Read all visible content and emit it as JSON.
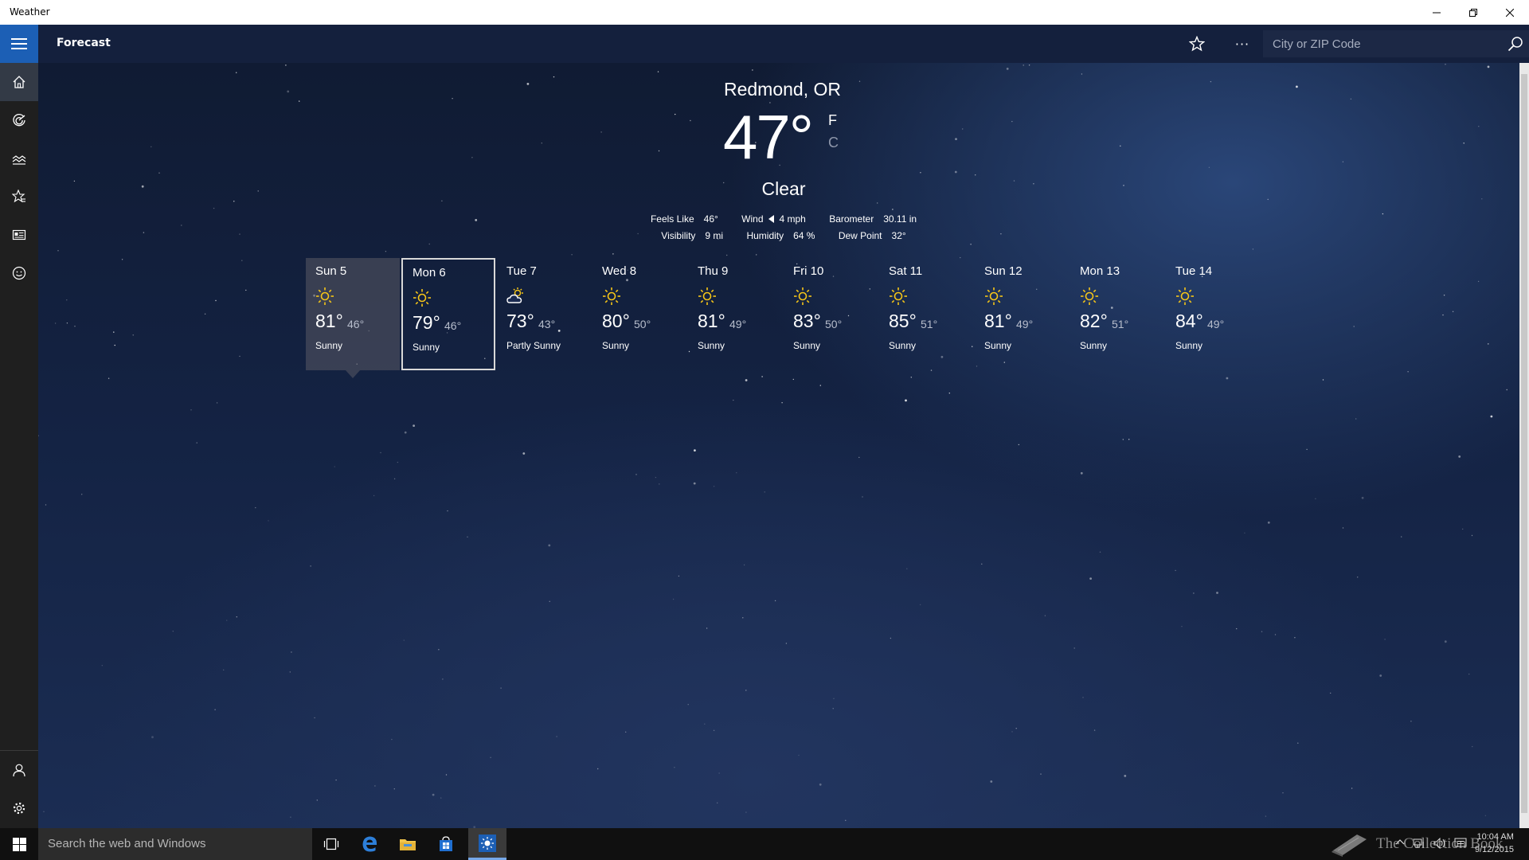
{
  "window": {
    "title": "Weather"
  },
  "appbar": {
    "heading": "Forecast",
    "more_label": "···",
    "search_placeholder": "City or ZIP Code"
  },
  "current": {
    "location": "Redmond, OR",
    "temperature": "47°",
    "unit_f": "F",
    "unit_c": "C",
    "condition": "Clear",
    "feels_like_label": "Feels Like",
    "feels_like": "46°",
    "wind_label": "Wind",
    "wind": "4 mph",
    "barometer_label": "Barometer",
    "barometer": "30.11 in",
    "visibility_label": "Visibility",
    "visibility": "9 mi",
    "humidity_label": "Humidity",
    "humidity": "64 %",
    "dew_point_label": "Dew Point",
    "dew_point": "32°"
  },
  "forecast": [
    {
      "day": "Sun 5",
      "hi": "81°",
      "lo": "46°",
      "cond": "Sunny",
      "icon": "sun-icon"
    },
    {
      "day": "Mon 6",
      "hi": "79°",
      "lo": "46°",
      "cond": "Sunny",
      "icon": "sun-icon"
    },
    {
      "day": "Tue 7",
      "hi": "73°",
      "lo": "43°",
      "cond": "Partly Sunny",
      "icon": "partly-sunny-icon"
    },
    {
      "day": "Wed 8",
      "hi": "80°",
      "lo": "50°",
      "cond": "Sunny",
      "icon": "sun-icon"
    },
    {
      "day": "Thu 9",
      "hi": "81°",
      "lo": "49°",
      "cond": "Sunny",
      "icon": "sun-icon"
    },
    {
      "day": "Fri 10",
      "hi": "83°",
      "lo": "50°",
      "cond": "Sunny",
      "icon": "sun-icon"
    },
    {
      "day": "Sat 11",
      "hi": "85°",
      "lo": "51°",
      "cond": "Sunny",
      "icon": "sun-icon"
    },
    {
      "day": "Sun 12",
      "hi": "81°",
      "lo": "49°",
      "cond": "Sunny",
      "icon": "sun-icon"
    },
    {
      "day": "Mon 13",
      "hi": "82°",
      "lo": "51°",
      "cond": "Sunny",
      "icon": "sun-icon"
    },
    {
      "day": "Tue 14",
      "hi": "84°",
      "lo": "49°",
      "cond": "Sunny",
      "icon": "sun-icon"
    }
  ],
  "sidebar": {
    "items": [
      {
        "icon": "home-icon"
      },
      {
        "icon": "radar-icon"
      },
      {
        "icon": "historical-weather-icon"
      },
      {
        "icon": "places-icon"
      },
      {
        "icon": "news-icon"
      },
      {
        "icon": "feedback-icon"
      }
    ],
    "bottom": [
      {
        "icon": "account-icon"
      },
      {
        "icon": "settings-icon"
      }
    ]
  },
  "taskbar": {
    "search_placeholder": "Search the web and Windows",
    "time": "10:04 AM",
    "date": "9/12/2015",
    "watermark": "The Collection Book"
  },
  "colors": {
    "accent": "#1c5fb5",
    "sun": "#f5c518",
    "appbar": "#14203d",
    "sidebar": "#1f1f1f"
  }
}
